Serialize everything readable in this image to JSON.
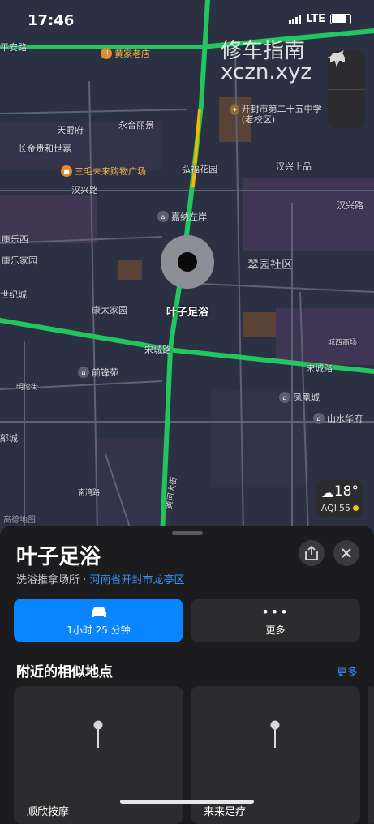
{
  "status": {
    "time": "17:46",
    "network": "LTE"
  },
  "watermark": {
    "line1": "修车指南",
    "line2": "xczn.xyz"
  },
  "map": {
    "district": "翠园社区",
    "pin_label": "叶子足浴",
    "attribution": "高德地图",
    "areas": [
      {
        "label": "康大家园"
      }
    ],
    "labels": [
      "平安路",
      "天爵府",
      "永合丽景",
      "长金贵和世嘉",
      "汉兴路",
      "弘福花园",
      "汉兴上品",
      "嘉纳左岸",
      "汉兴路",
      "康乐西",
      "康乐家园",
      "世纪城",
      "康太家园",
      "宋城路",
      "宋城路",
      "前锋苑",
      "凤凰城",
      "山水华府",
      "城西商场",
      "南湾路",
      "明伦街",
      "大河大街",
      "鄗城",
      "黄河大街"
    ],
    "pois": [
      {
        "name": "黄家老店",
        "type": "food"
      },
      {
        "name": "三毛未来购物广场",
        "type": "shop"
      },
      {
        "name": "开封市第二十五中学(老校区)",
        "type": "school"
      },
      {
        "name": "嘉纳左岸",
        "type": "home"
      }
    ],
    "weather": {
      "temp": "18°",
      "aqi_label": "AQI",
      "aqi_value": "55"
    }
  },
  "sheet": {
    "title": "叶子足浴",
    "category": "洗浴推拿场所",
    "separator": "·",
    "address": "河南省开封市龙亭区",
    "primary_action": "1小时 25 分钟",
    "secondary_action": "更多",
    "nearby_title": "附近的相似地点",
    "nearby_more": "更多",
    "nearby": [
      {
        "name": "顺欣按摩"
      },
      {
        "name": "来来足疗"
      }
    ]
  },
  "colors": {
    "accent": "#0a84ff",
    "road_green": "#22c55e",
    "road_yellow": "#f2b700"
  }
}
